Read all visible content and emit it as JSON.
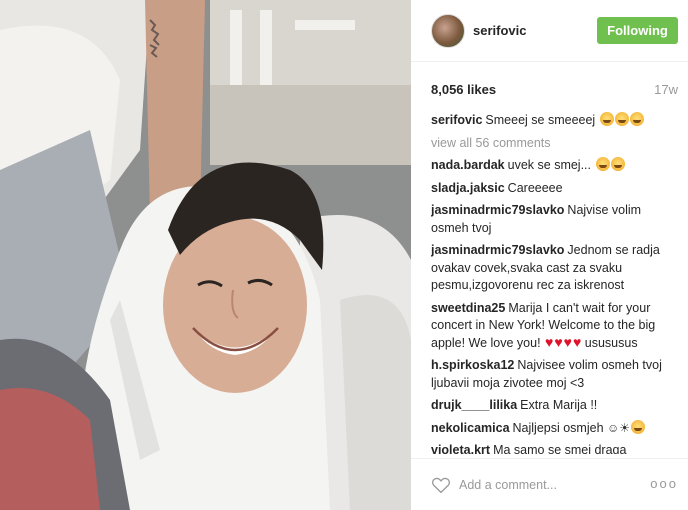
{
  "post": {
    "username": "serifovic",
    "follow_label": "Following",
    "likes": "8,056 likes",
    "time": "17w"
  },
  "comments": {
    "view_all": "view all 56 comments",
    "items": [
      {
        "user": "serifovic",
        "text": "Smeeej se smeeeej",
        "emoji": 3
      },
      {
        "user": "nada.bardak",
        "text": "uvek se smej...",
        "emoji": 2
      },
      {
        "user": "sladja.jaksic",
        "text": "Careeeee",
        "emoji": 0
      },
      {
        "user": "jasminadrmic79slavko",
        "text": "Najvise volim osmeh tvoj",
        "emoji": 0
      },
      {
        "user": "jasminadrmic79slavko",
        "text": "Jednom se radja ovakav covek,svaka cast za svaku pesmu,izgovorenu rec za iskrenost",
        "emoji": 0
      },
      {
        "user": "sweetdina25",
        "text": "Marija I can't wait for your concert in New York! Welcome to the big apple! We love you!",
        "hearts": 4,
        "tail": "usususus"
      },
      {
        "user": "h.spirkoska12",
        "text": "Najvisee volim osmeh tvoj ljubavii moja zivotee moj <3",
        "emoji": 0
      },
      {
        "user": "drujk____lilika",
        "text": "Extra Marija !!",
        "emoji": 0
      },
      {
        "user": "nekolicamica",
        "text": "Najljepsi osmjeh",
        "sun": "☺☀",
        "emoji": 1
      },
      {
        "user": "violeta.krt",
        "text": "Ma samo se smej draga",
        "emoji": 0
      }
    ]
  },
  "footer": {
    "comment_placeholder": "Add a comment...",
    "more_label": "ooo"
  },
  "colors": {
    "follow_green": "#70c050",
    "heart_red": "#e0112b"
  },
  "icons": {
    "like": "heart-outline-icon",
    "more": "more-options-icon"
  }
}
